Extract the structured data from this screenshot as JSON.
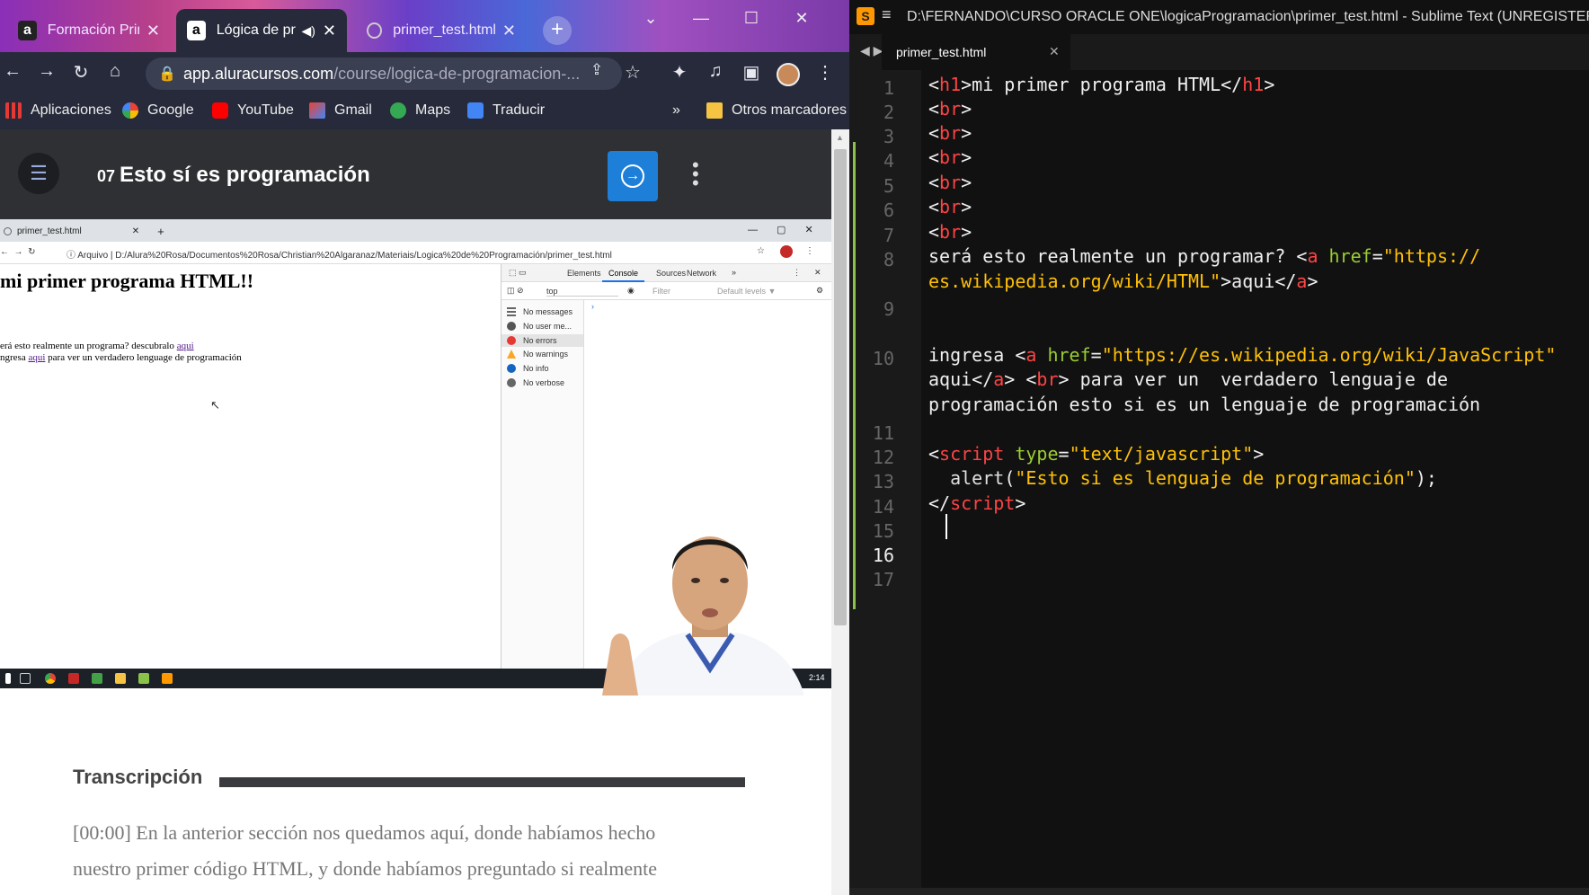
{
  "chrome": {
    "tabs": [
      {
        "label": "Formación Principia",
        "favicon": "a"
      },
      {
        "label": "Lógica de programación",
        "favicon": "a",
        "audio": "🔇"
      },
      {
        "label": "primer_test.html",
        "favicon": "globe"
      }
    ],
    "url_host": "app.aluracursos.com",
    "url_path": "/course/logica-de-programacion-...",
    "bookmarks": [
      "Aplicaciones",
      "Google",
      "YouTube",
      "Gmail",
      "Maps",
      "Traducir"
    ],
    "other_bookmarks": "Otros marcadores",
    "overflow": "»"
  },
  "lesson": {
    "number": "07",
    "title": "Esto sí es programación"
  },
  "video": {
    "inner_tab": "primer_test.html",
    "inner_addr_label": "Arquivo",
    "inner_path": "D:/Alura%20Rosa/Documentos%20Rosa/Christian%20Algaranaz/Materiais/Logica%20de%20Programación/primer_test.html",
    "page_h1": "mi primer programa HTML!!",
    "line1_text": "erá esto realmente un programa? descubralo",
    "line1_link": "aqui",
    "line2_start": "ngresa",
    "line2_link": "aqui",
    "line2_end": "para ver un verdadero lenguage de programación",
    "devtools_tabs": [
      "Elements",
      "Console",
      "Sources",
      "Network"
    ],
    "devtools_context": "top",
    "devtools_filter": "Filter",
    "devtools_levels": "Default levels ▼",
    "messages": [
      "No messages",
      "No user me...",
      "No errors",
      "No warnings",
      "No info",
      "No verbose"
    ],
    "clock": "2:14"
  },
  "transcription": {
    "heading": "Transcripción",
    "line1": "[00:00] En la anterior sección nos quedamos aquí, donde habíamos hecho",
    "line2": "nuestro primer código HTML, y donde habíamos preguntado si realmente"
  },
  "sublime": {
    "title": "D:\\FERNANDO\\CURSO ORACLE ONE\\logicaProgramacion\\primer_test.html - Sublime Text (UNREGISTERED)",
    "tab": "primer_test.html",
    "line_numbers": [
      "1",
      "2",
      "3",
      "4",
      "5",
      "6",
      "7",
      "8",
      "",
      "9",
      "10",
      "",
      "",
      "11",
      "12",
      "13",
      "14",
      "15",
      "16",
      "17"
    ],
    "current_line": "16"
  },
  "colors": {
    "accent_blue": "#1e7fd8",
    "sublime_tag": "#ff4444",
    "sublime_attr": "#9acd32",
    "sublime_string": "#ffc107"
  }
}
